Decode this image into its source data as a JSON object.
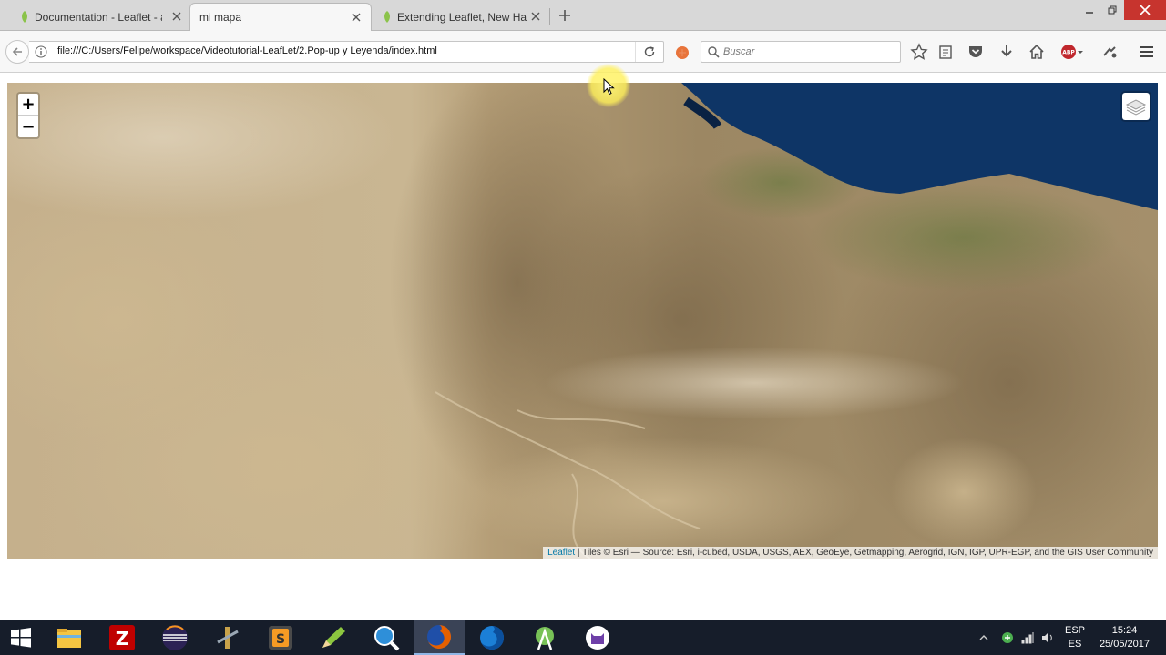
{
  "browser": {
    "tabs": [
      {
        "title": "Documentation - Leaflet - a",
        "active": false
      },
      {
        "title": "mi mapa",
        "active": true
      },
      {
        "title": "Extending Leaflet, New Hand",
        "active": false
      }
    ],
    "address_url": "file:///C:/Users/Felipe/workspace/Videotutorial-LeafLet/2.Pop-up y Leyenda/index.html",
    "search_placeholder": "Buscar",
    "toolbar_icons": [
      "bookmark-star-icon",
      "reading-list-icon",
      "pocket-icon",
      "download-icon",
      "home-icon",
      "adblock-icon",
      "extension-icon",
      "menu-icon"
    ]
  },
  "map": {
    "zoom_in_label": "+",
    "zoom_out_label": "−",
    "attribution_link": "Leaflet",
    "attribution_text": " | Tiles © Esri — Source: Esri, i-cubed, USDA, USGS, AEX, GeoEye, Getmapping, Aerogrid, IGN, IGP, UPR-EGP, and the GIS User Community",
    "colors": {
      "sand": "#c8b38e",
      "sea": "#0e3566",
      "rock": "#8f7a5a",
      "vegetation": "#6f7b44"
    }
  },
  "taskbar": {
    "apps": [
      "start-icon",
      "file-explorer-icon",
      "filezilla-icon",
      "eclipse-icon",
      "tools-icon",
      "sublime-text-icon",
      "pencil-app-icon",
      "search-app-icon",
      "firefox-icon",
      "firefox-dev-icon",
      "android-studio-icon",
      "github-icon"
    ],
    "lang_top": "ESP",
    "lang_bottom": "ES",
    "time": "15:24",
    "date": "25/05/2017"
  }
}
